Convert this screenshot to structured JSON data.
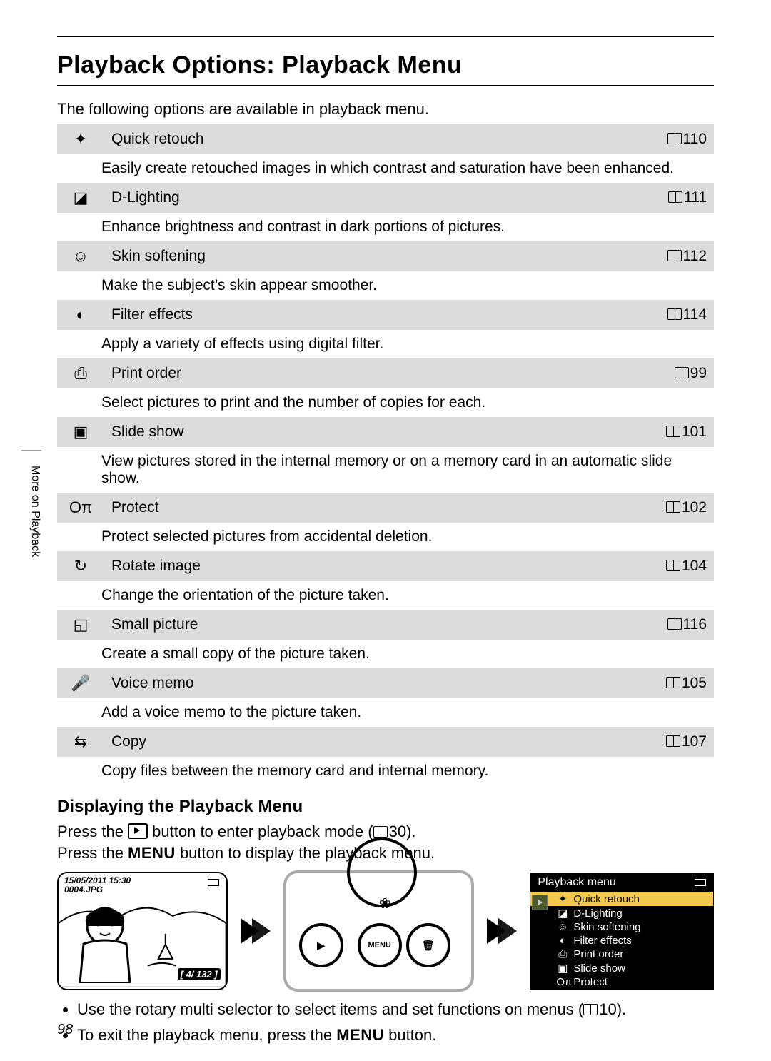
{
  "page_number": "98",
  "side_tab": "More on Playback",
  "title": "Playback Options: Playback Menu",
  "intro": "The following options are available in playback menu.",
  "book_refs": {
    "playback_mode": "30",
    "menus": "10"
  },
  "options": [
    {
      "icon": "✦",
      "name": "Quick retouch",
      "page": "110",
      "desc": "Easily create retouched images in which contrast and saturation have been enhanced."
    },
    {
      "icon": "◪",
      "name": "D-Lighting",
      "page": "111",
      "desc": "Enhance brightness and contrast in dark portions of pictures."
    },
    {
      "icon": "☺",
      "name": "Skin softening",
      "page": "112",
      "desc": "Make the subject’s skin appear smoother."
    },
    {
      "icon": "◐",
      "name": "Filter effects",
      "page": "114",
      "desc": "Apply a variety of effects using digital filter."
    },
    {
      "icon": "⎙",
      "name": "Print order",
      "page": "99",
      "desc": "Select pictures to print and the number of copies for each."
    },
    {
      "icon": "▣",
      "name": "Slide show",
      "page": "101",
      "desc": "View pictures stored in the internal memory or on a memory card in an automatic slide show."
    },
    {
      "icon": "Oπ",
      "name": "Protect",
      "page": "102",
      "desc": "Protect selected pictures from accidental deletion."
    },
    {
      "icon": "↻",
      "name": "Rotate image",
      "page": "104",
      "desc": "Change the orientation of the picture taken."
    },
    {
      "icon": "◱",
      "name": "Small picture",
      "page": "116",
      "desc": "Create a small copy of the picture taken."
    },
    {
      "icon": "🎤",
      "name": "Voice memo",
      "page": "105",
      "desc": "Add a voice memo to the picture taken."
    },
    {
      "icon": "⇆",
      "name": "Copy",
      "page": "107",
      "desc": "Copy files between the memory card and internal memory."
    }
  ],
  "subheading": "Displaying the Playback Menu",
  "press_line1_a": "Press the ",
  "press_line1_b": " button to enter playback mode (",
  "press_line1_c": ").",
  "press_line2_a": "Press the ",
  "press_line2_b": " button to display the playback menu.",
  "menu_word": "MENU",
  "preview": {
    "timestamp": "15/05/2011 15:30",
    "filename": "0004.JPG",
    "counter": "4/ 132"
  },
  "camera_buttons": {
    "play": "▶",
    "menu": "MENU",
    "flower": "❀",
    "trash": "🗑"
  },
  "playback_menu_panel": {
    "title": "Playback menu",
    "items": [
      {
        "icon": "✦",
        "label": "Quick retouch",
        "selected": true
      },
      {
        "icon": "◪",
        "label": "D-Lighting"
      },
      {
        "icon": "☺",
        "label": "Skin softening"
      },
      {
        "icon": "◐",
        "label": "Filter effects"
      },
      {
        "icon": "⎙",
        "label": "Print order"
      },
      {
        "icon": "▣",
        "label": "Slide show"
      },
      {
        "icon": "Oπ",
        "label": "Protect"
      }
    ]
  },
  "bullets": {
    "b1a": "Use the rotary multi selector to select items and set functions on menus (",
    "b1b": ").",
    "b2a": "To exit the playback menu, press the ",
    "b2b": " button."
  }
}
